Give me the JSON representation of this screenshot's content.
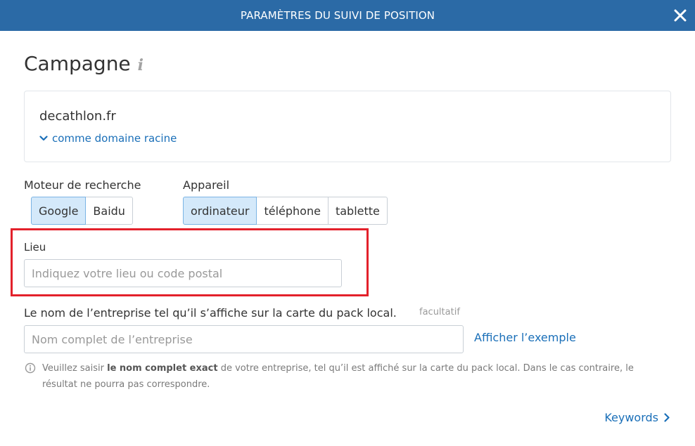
{
  "header": {
    "title": "PARAMÈTRES DU SUIVI DE POSITION",
    "close_icon": "close-icon"
  },
  "campaign": {
    "title": "Campagne",
    "info_icon": "i"
  },
  "domain": {
    "name": "decathlon.fr",
    "type_label": "comme domaine racine"
  },
  "search_engine": {
    "label": "Moteur de recherche",
    "options": [
      "Google",
      "Baidu"
    ],
    "selected": "Google"
  },
  "device": {
    "label": "Appareil",
    "options": [
      "ordinateur",
      "téléphone",
      "tablette"
    ],
    "selected": "ordinateur"
  },
  "location": {
    "label": "Lieu",
    "value": "",
    "placeholder": "Indiquez votre lieu ou code postal"
  },
  "business": {
    "label": "Le nom de l’entreprise tel qu’il s’affiche sur la carte du pack local.",
    "optional_label": "facultatif",
    "value": "",
    "placeholder": "Nom complet de l’entreprise",
    "example_link": "Afficher l’exemple"
  },
  "note": {
    "prefix": "Veuillez saisir ",
    "bold": "le nom complet exact",
    "suffix": " de votre entreprise, tel qu’il est affiché sur la carte du pack local. Dans le cas contraire, le résultat ne pourra pas correspondre."
  },
  "footer": {
    "next_link": "Keywords"
  },
  "colors": {
    "header_bg": "#2b6aa6",
    "link": "#1a6fb8",
    "active_segment_bg": "#d4e9fa",
    "highlight_border": "#e3212b"
  }
}
